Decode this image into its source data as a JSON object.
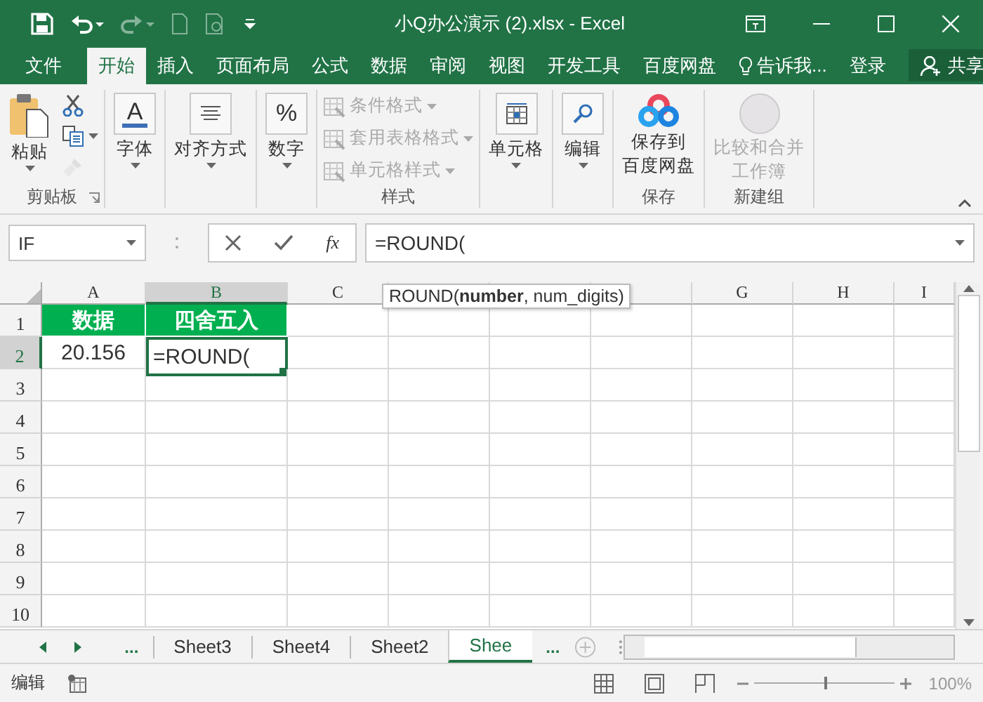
{
  "title_bar": {
    "title": "小Q办公演示 (2).xlsx - Excel"
  },
  "menu": {
    "tabs": [
      {
        "label": "文件",
        "selected": false
      },
      {
        "label": "开始",
        "selected": true
      },
      {
        "label": "插入",
        "selected": false
      },
      {
        "label": "页面布局",
        "selected": false
      },
      {
        "label": "公式",
        "selected": false
      },
      {
        "label": "数据",
        "selected": false
      },
      {
        "label": "审阅",
        "selected": false
      },
      {
        "label": "视图",
        "selected": false
      },
      {
        "label": "开发工具",
        "selected": false
      },
      {
        "label": "百度网盘",
        "selected": false
      }
    ],
    "tell_me": "告诉我...",
    "sign_in": "登录",
    "share": "共享"
  },
  "ribbon": {
    "groups": [
      {
        "label": "剪贴板",
        "items": [
          {
            "kind": "large",
            "label": "粘贴",
            "dropdown": true,
            "disabled": false
          },
          {
            "kind": "icon",
            "disabled": false
          },
          {
            "kind": "icon",
            "dropdown": true,
            "disabled": false
          },
          {
            "kind": "icon",
            "disabled": true
          }
        ]
      },
      {
        "items": [
          {
            "kind": "boxed",
            "glyph": "A",
            "label": "字体",
            "dropdown": true,
            "disabled": false
          }
        ]
      },
      {
        "items": [
          {
            "kind": "boxed",
            "label": "对齐方式",
            "dropdown": true,
            "disabled": false
          }
        ]
      },
      {
        "items": [
          {
            "kind": "boxed",
            "glyph": "%",
            "label": "数字",
            "dropdown": true,
            "disabled": false
          }
        ]
      },
      {
        "label": "样式",
        "items": [
          {
            "kind": "small",
            "label": "条件格式",
            "dropdown": true,
            "disabled": true
          },
          {
            "kind": "small",
            "label": "套用表格格式",
            "dropdown": true,
            "disabled": true
          },
          {
            "kind": "small",
            "label": "单元格样式",
            "dropdown": true,
            "disabled": true
          }
        ]
      },
      {
        "items": [
          {
            "kind": "boxed",
            "label": "单元格",
            "dropdown": true,
            "disabled": false
          }
        ]
      },
      {
        "items": [
          {
            "kind": "boxed",
            "label": "编辑",
            "dropdown": true,
            "disabled": false
          }
        ]
      },
      {
        "label": "保存",
        "items": [
          {
            "kind": "large",
            "lines": [
              "保存到",
              "百度网盘"
            ],
            "disabled": false
          }
        ]
      },
      {
        "label": "新建组",
        "items": [
          {
            "kind": "large",
            "lines": [
              "比较和合并",
              "工作簿"
            ],
            "disabled": true
          }
        ]
      }
    ]
  },
  "formula_bar": {
    "name_box": "IF",
    "fx": "fx",
    "formula": "=ROUND("
  },
  "grid": {
    "columns": [
      {
        "label": "A",
        "selected": false
      },
      {
        "label": "B",
        "selected": true
      },
      {
        "label": "C",
        "selected": false
      },
      {
        "selected": false
      },
      {
        "selected": false
      },
      {
        "selected": false
      },
      {
        "label": "G",
        "selected": false
      },
      {
        "label": "H",
        "selected": false
      },
      {
        "label": "I",
        "selected": false
      }
    ],
    "rows": [
      {
        "header": "1",
        "selected": false,
        "cells": [
          {
            "text": "数据",
            "kind": "header",
            "selected": false
          },
          {
            "text": "四舍五入",
            "kind": "header",
            "selected": false
          }
        ]
      },
      {
        "header": "2",
        "selected": true,
        "cells": [
          {
            "text": "20.156",
            "kind": "number",
            "selected": false
          },
          {
            "text": "=ROUND(",
            "kind": "formula",
            "selected": true
          }
        ]
      },
      {
        "header": "3",
        "selected": false
      },
      {
        "header": "4",
        "selected": false
      },
      {
        "header": "5",
        "selected": false
      },
      {
        "header": "6",
        "selected": false
      },
      {
        "header": "7",
        "selected": false
      },
      {
        "header": "8",
        "selected": false
      },
      {
        "header": "9",
        "selected": false
      },
      {
        "header": "10",
        "selected": false
      }
    ],
    "tooltip": "ROUND(**number**, num_digits)"
  },
  "sheet_tabs": {
    "more_left": "...",
    "tabs": [
      {
        "label": "Sheet3",
        "selected": false
      },
      {
        "label": "Sheet4",
        "selected": false
      },
      {
        "label": "Sheet2",
        "selected": false
      },
      {
        "label": "Shee",
        "selected": true
      }
    ],
    "more_right": "..."
  },
  "status_bar": {
    "mode": "编辑",
    "zoom": {
      "label": "100%",
      "level": 0.5
    }
  }
}
